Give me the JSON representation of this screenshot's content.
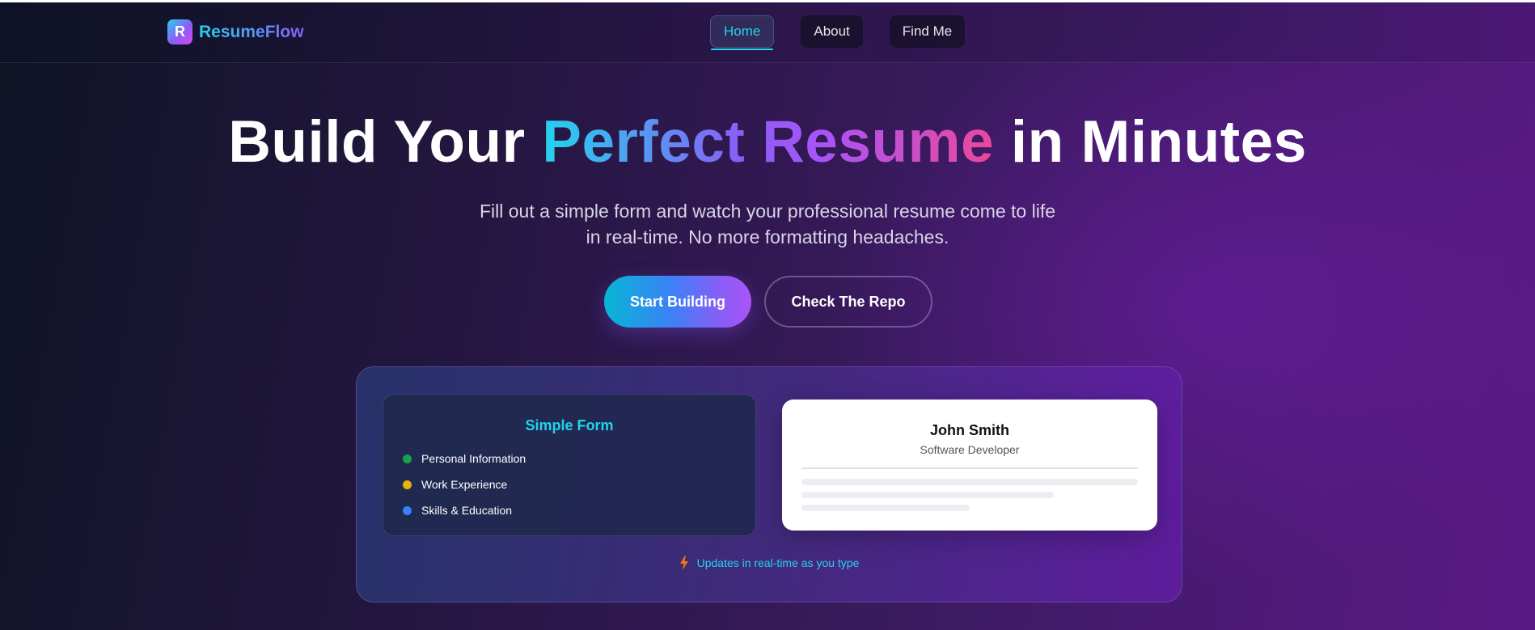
{
  "nav": {
    "logo_letter": "R",
    "brand": "ResumeFlow",
    "items": [
      {
        "label": "Home",
        "active": true
      },
      {
        "label": "About",
        "active": false
      },
      {
        "label": "Find Me",
        "active": false
      }
    ]
  },
  "hero": {
    "title_start": "Build Your ",
    "title_highlight": "Perfect Resume",
    "title_end": " in Minutes",
    "subtitle_line1": "Fill out a simple form and watch your professional resume come to life",
    "subtitle_line2": "in real-time. No more formatting headaches.",
    "primary_cta": "Start Building",
    "secondary_cta": "Check The Repo"
  },
  "demo": {
    "form_title": "Simple Form",
    "form_items": [
      {
        "label": "Personal Information",
        "color": "#16a34a"
      },
      {
        "label": "Work Experience",
        "color": "#eab308"
      },
      {
        "label": "Skills & Education",
        "color": "#3b82f6"
      }
    ],
    "preview_name": "John Smith",
    "preview_role": "Software Developer",
    "realtime_note": "Updates in real-time as you type"
  },
  "colors": {
    "accent_cyan": "#22d3ee",
    "accent_purple": "#8b5cf6",
    "accent_pink": "#ec4899"
  },
  "icons": {
    "realtime_icon": "lightning-bolt-icon"
  }
}
